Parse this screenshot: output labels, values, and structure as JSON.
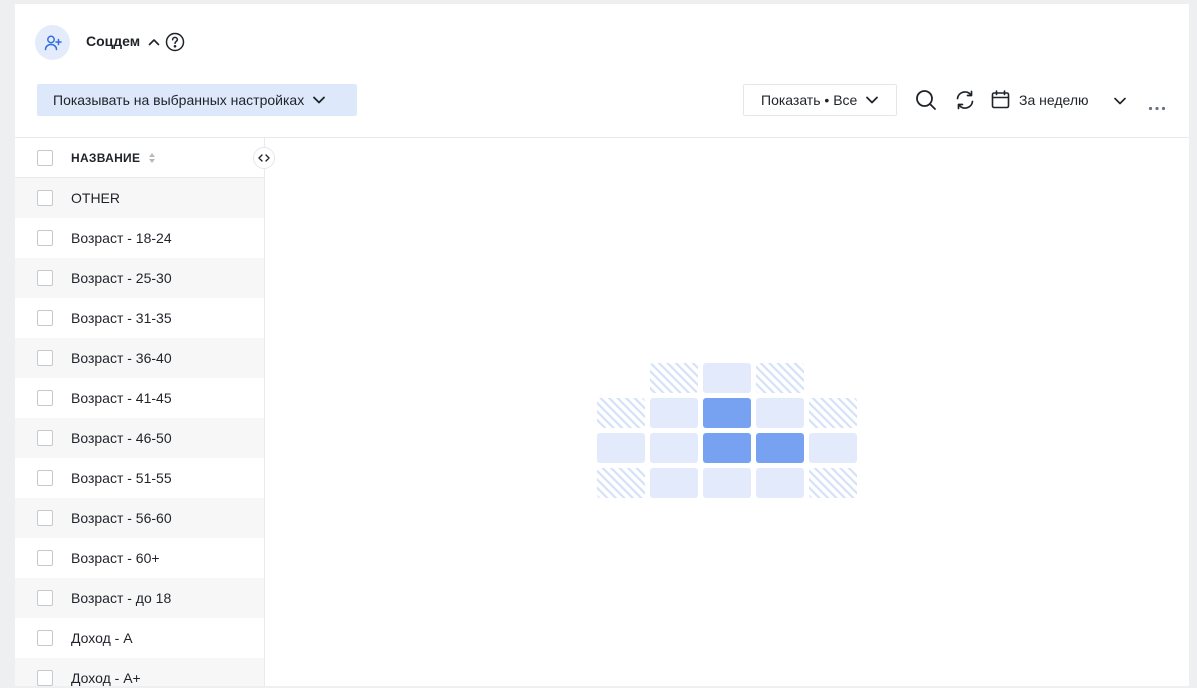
{
  "header": {
    "title": "Соцдем",
    "filter_button_label": "Показывать на выбранных настройках",
    "show_button_label": "Показать • Все",
    "period_label": "За неделю"
  },
  "table": {
    "column_header": "НАЗВАНИЕ",
    "rows": [
      "OTHER",
      "Возраст - 18-24",
      "Возраст - 25-30",
      "Возраст - 31-35",
      "Возраст - 36-40",
      "Возраст - 41-45",
      "Возраст - 46-50",
      "Возраст - 51-55",
      "Возраст - 56-60",
      "Возраст - 60+",
      "Возраст - до 18",
      "Доход - А",
      "Доход - А+"
    ]
  },
  "colors": {
    "accent": "#2f6fe0",
    "filter_bg": "#dde8fa",
    "illustration_light": "#e2eafb",
    "illustration_dark": "#77a2f2"
  },
  "icons": {
    "avatar": "user-plus-icon",
    "title_toggle": "chevron-up-icon",
    "help": "question-circle-icon",
    "filter_dropdown": "chevron-down-icon",
    "show_dropdown": "chevron-down-icon",
    "search": "search-icon",
    "refresh": "refresh-icon",
    "calendar": "calendar-icon",
    "period_dropdown": "chevron-down-icon",
    "more": "more-horizontal-icon",
    "sort": "sort-icon",
    "collapse": "code-arrows-icon"
  }
}
